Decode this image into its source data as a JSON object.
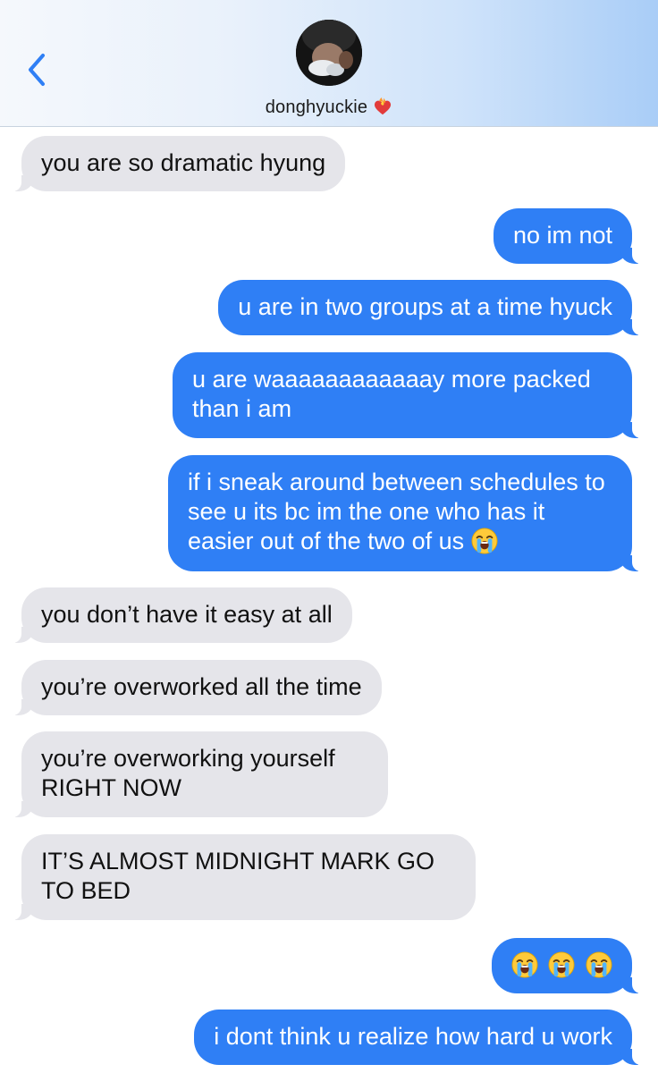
{
  "header": {
    "contact_name": "donghyuckie",
    "back_icon": "chevron-left-icon",
    "name_emoji": "heart-on-fire-icon",
    "accent_color": "#2f7ff5"
  },
  "messages": [
    {
      "direction": "received",
      "text": "you are so dramatic hyung"
    },
    {
      "direction": "sent",
      "text": "no im not"
    },
    {
      "direction": "sent",
      "text": "u are in two groups at a time hyuck"
    },
    {
      "direction": "sent",
      "text": "u are waaaaaaaaaaaay more packed than i am"
    },
    {
      "direction": "sent",
      "text": "if i sneak around between schedules to see u its bc im the one who has it easier out of the two of us",
      "emoji": "loudly-crying-face-icon"
    },
    {
      "direction": "received",
      "text": "you don’t have it easy at all"
    },
    {
      "direction": "received",
      "text": "you’re overworked all the time"
    },
    {
      "direction": "received",
      "text": "you’re overworking yourself RIGHT NOW"
    },
    {
      "direction": "received",
      "text": "IT’S ALMOST MIDNIGHT MARK GO TO BED"
    },
    {
      "direction": "sent",
      "text": "",
      "emoji": "loudly-crying-face-icon",
      "emoji_count": 3
    },
    {
      "direction": "sent",
      "text": "i dont think u realize how hard u work"
    }
  ]
}
